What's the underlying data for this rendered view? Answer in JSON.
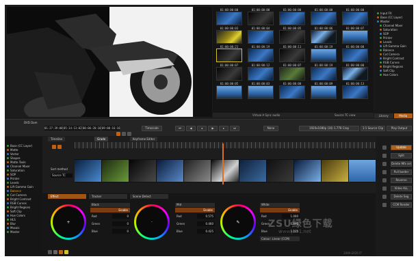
{
  "viewer": {},
  "browser": {
    "timecodes": [
      [
        "01:00:00:00",
        "01:00:00:00",
        "01:00:00:00",
        "01:00:00:00",
        "01:00:00:00"
      ],
      [
        "01:00:00:03",
        "01:00:00:04",
        "01:00:00:05",
        "01:00:00:06",
        "01:00:00:07"
      ],
      [
        "01:00:00:21",
        "01:00:00:19",
        "01:00:00:11",
        "01:00:00:19",
        "01:00:00:00"
      ],
      [
        "01:00:00:07",
        "01:00:00:12",
        "01:00:00:07",
        "01:00:00:19",
        "01:00:00:00"
      ],
      [
        "01:00:00:05",
        "01:00:00:03",
        "01:00:00:00",
        "01:00:00:09",
        "01:00:00:13"
      ]
    ],
    "bottom_bar": {
      "left": "Virtual A Sync audio",
      "right": "Source TC view"
    }
  },
  "right_tree": {
    "items": [
      "Input FX",
      "Base (CC Layer)",
      "Master",
      "Channel Mixer",
      "Saturation",
      "SOP",
      "Printer",
      "Levels",
      "Lift Gamma Gain",
      "Balance",
      "Cut Camera",
      "Bright Contrast",
      "RGB Curves",
      "Bright Regions",
      "Soft Clip",
      "Hue Colors"
    ],
    "tabs": [
      "Library",
      "Media"
    ]
  },
  "tcbar": {
    "label_top": "DVD Dam",
    "tc1": "01:27:39:08",
    "tc2": "05:14:13:02",
    "tc3": "00:06:20:10",
    "tc4": "09:00:16:16",
    "timecode_btn": "Timecode",
    "none_btn": "None",
    "res_btn": "1920x1080p (16) 1.778 Crop",
    "source_btn": "1:1 Source Clip",
    "play_btn": "Play Output"
  },
  "timeline": {
    "tabs": [
      "Timeline",
      "Grade",
      "Keyframe Editor"
    ],
    "sort_label": "Sort method",
    "sort_value": "Source TC",
    "left_tree": [
      "Base (CC Layer)",
      "Matte",
      "Vector",
      "Shapes",
      "Matte Tools",
      "Channel Mixer",
      "Saturation",
      "SOP",
      "Printer",
      "Levels",
      "Lift Gamma Gain",
      "Balance",
      "Cut Camera",
      "Bright Contrast",
      "RGB Curves",
      "Bright Regions",
      "Soft Clip",
      "Hue Colors",
      "HLS",
      "Blur",
      "Mosaic",
      "Master"
    ]
  },
  "panels": {
    "tabs": [
      "Effect",
      "Tracker",
      "Scene Detect"
    ],
    "black": {
      "header": "Black",
      "enable": "Enable",
      "red": "0",
      "green": "0",
      "blue": "0"
    },
    "mid": {
      "header": "Mid",
      "enable": "Enable",
      "red": "0.575",
      "green": "0.460",
      "blue": "0.425"
    },
    "white": {
      "header": "White",
      "enable": "Enable",
      "red": "1.000",
      "green": "0.996",
      "blue": "1.014",
      "colour": "Colour: Linear (CCM)"
    },
    "labels": {
      "red": "Red",
      "green": "Green",
      "blue": "Blue"
    }
  },
  "rtools": {
    "buttons": [
      "Update",
      "Split",
      "Delete Mfx sel",
      "Pull border",
      "Reverse",
      "Video ALL",
      "Delete Seg",
      "CCM Render"
    ]
  },
  "watermark": "ZSU绿色下载",
  "watermark2": "www.jb51.net",
  "watermark3": "1999-2020 IT"
}
